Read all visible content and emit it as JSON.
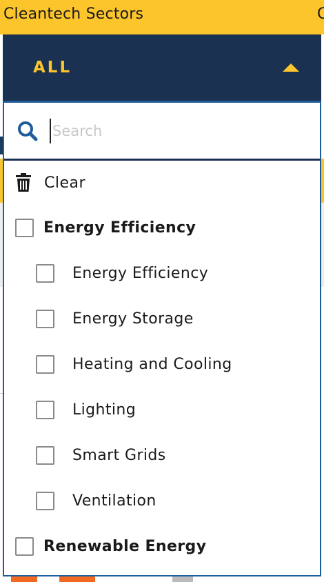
{
  "page": {
    "header_title": "Cleantech Sectors",
    "header_cut_text": "C"
  },
  "select": {
    "value": "ALL",
    "expanded": true
  },
  "dropdown": {
    "search": {
      "placeholder": "Search",
      "value": ""
    },
    "clear_label": "Clear",
    "options": [
      {
        "label": "Energy Efficiency",
        "level": "group",
        "checked": false
      },
      {
        "label": "Energy Efficiency",
        "level": "child",
        "checked": false
      },
      {
        "label": "Energy Storage",
        "level": "child",
        "checked": false
      },
      {
        "label": "Heating and Cooling",
        "level": "child",
        "checked": false
      },
      {
        "label": "Lighting",
        "level": "child",
        "checked": false
      },
      {
        "label": "Smart Grids",
        "level": "child",
        "checked": false
      },
      {
        "label": "Ventilation",
        "level": "child",
        "checked": false
      },
      {
        "label": "Renewable Energy",
        "level": "group",
        "checked": false
      }
    ]
  },
  "icons": {
    "search": "search-icon",
    "clear": "trash-icon",
    "caret": "caret-up-icon"
  },
  "colors": {
    "brand_yellow": "#fcc52c",
    "brand_navy": "#1b3152",
    "panel_border": "#1f5c9a",
    "search_icon": "#1f5c9a",
    "checkbox_border": "#8a8a8a"
  }
}
